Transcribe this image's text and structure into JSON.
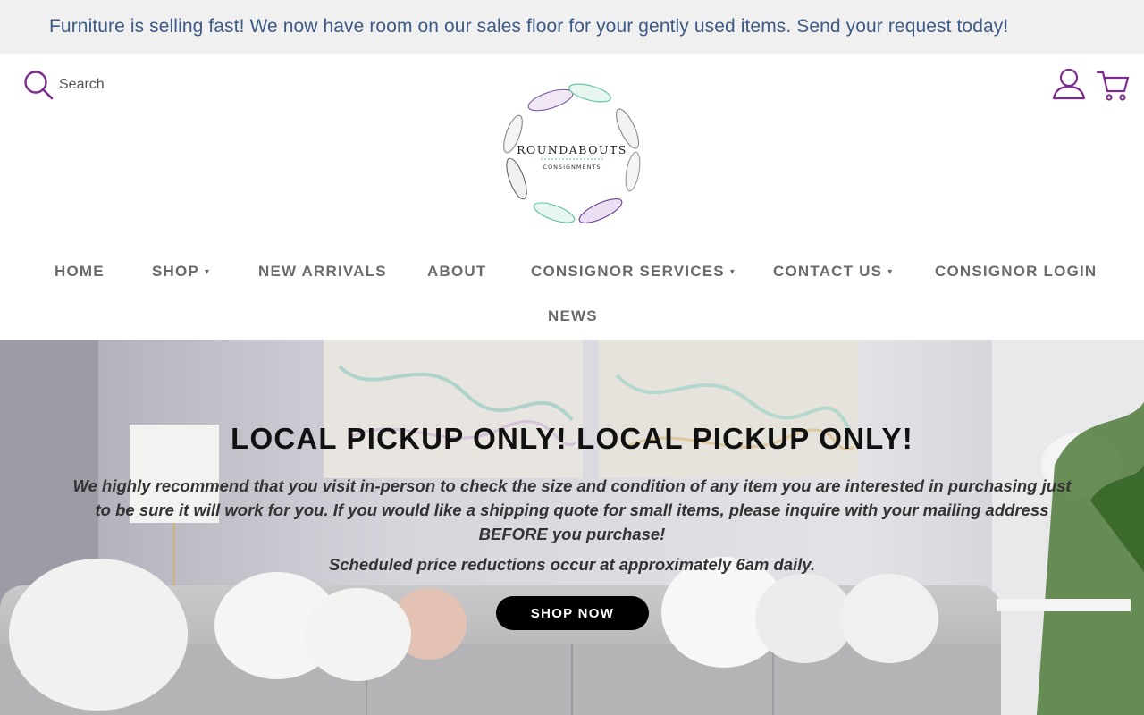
{
  "announcement": {
    "text": "Furniture is selling fast! We now have room on our sales floor for your gently used items. Send your request today!"
  },
  "header": {
    "search_label": "Search",
    "logo": {
      "name": "ROUNDABOUTS",
      "tagline": "CONSIGNMENTS"
    },
    "icons": [
      "search-icon",
      "account-icon",
      "cart-icon"
    ],
    "accent_color": "#7b2d8e"
  },
  "nav": {
    "items": [
      {
        "label": "HOME",
        "dropdown": false
      },
      {
        "label": "SHOP",
        "dropdown": true
      },
      {
        "label": "NEW ARRIVALS",
        "dropdown": false
      },
      {
        "label": "ABOUT",
        "dropdown": false
      },
      {
        "label": "CONSIGNOR SERVICES",
        "dropdown": true
      },
      {
        "label": "CONTACT US",
        "dropdown": true
      },
      {
        "label": "CONSIGNOR LOGIN",
        "dropdown": false
      },
      {
        "label": "NEWS",
        "dropdown": false
      }
    ],
    "caret": "▾"
  },
  "hero": {
    "title": "LOCAL PICKUP ONLY! LOCAL PICKUP ONLY!",
    "text": "We highly recommend that you visit in-person to check the size and condition of any item you are interested in purchasing just to be sure it will work for you. If you would like a shipping quote for small items, please inquire with your mailing address BEFORE you purchase!",
    "text2": "Scheduled price reductions occur at approximately 6am daily.",
    "button_label": "SHOP NOW"
  }
}
